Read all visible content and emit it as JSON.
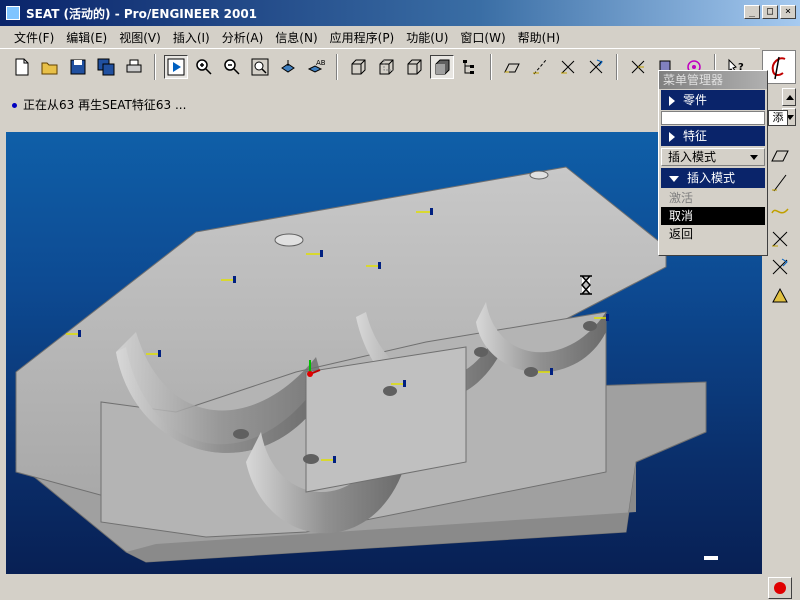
{
  "window": {
    "title": "SEAT (活动的) - Pro/ENGINEER 2001",
    "buttons": [
      "_",
      "□",
      "×"
    ]
  },
  "menubar": {
    "items": [
      "文件(F)",
      "编辑(E)",
      "视图(V)",
      "插入(I)",
      "分析(A)",
      "信息(N)",
      "应用程序(P)",
      "功能(U)",
      "窗口(W)",
      "帮助(H)"
    ]
  },
  "message": {
    "text": "正在从63 再生SEAT特征63 ..."
  },
  "menu_manager": {
    "title": "菜单管理器",
    "part_header": "零件",
    "input_tag": "添",
    "feature_header": "特征",
    "insert_mode_option": "插入模式",
    "insert_mode_header": "插入模式",
    "items": [
      "激活",
      "取消",
      "返回"
    ],
    "selected_index": 1,
    "disabled_index": 0
  },
  "colors": {
    "viewport_top": "#0f5fa8",
    "viewport_bottom": "#082054",
    "titlebar": "#0a246a",
    "part": "#b8b8b8"
  }
}
